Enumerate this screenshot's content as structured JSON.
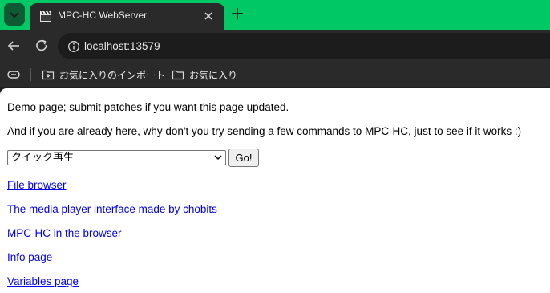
{
  "browser": {
    "tab": {
      "title": "MPC-HC WebServer"
    },
    "address_bar": {
      "url": "localhost:13579"
    },
    "bookmarks": [
      {
        "label": "お気に入りのインポート"
      },
      {
        "label": "お気に入り"
      }
    ],
    "accent_color": "#00c864"
  },
  "page": {
    "intro": "Demo page; submit patches if you want this page updated.",
    "prompt": "And if you are already here, why don't you try sending a few commands to MPC-HC, just to see if it works :)",
    "command_select": {
      "selected": "クイック再生"
    },
    "go_button": "Go!",
    "links": [
      "File browser",
      "The media player interface made by chobits",
      "MPC-HC in the browser",
      "Info page",
      "Variables page"
    ]
  }
}
